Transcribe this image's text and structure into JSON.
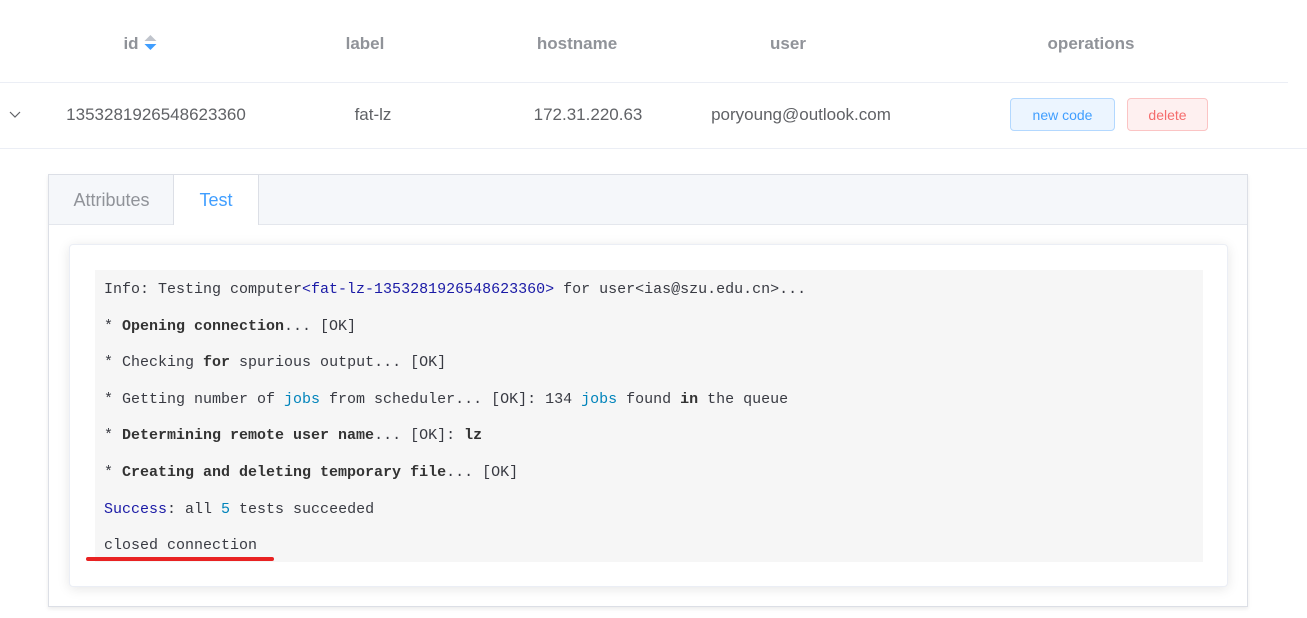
{
  "table": {
    "columns": [
      {
        "key": "id",
        "label": "id",
        "sortable": true,
        "sort": "descending"
      },
      {
        "key": "label",
        "label": "label"
      },
      {
        "key": "hostname",
        "label": "hostname"
      },
      {
        "key": "user",
        "label": "user"
      },
      {
        "key": "operations",
        "label": "operations"
      }
    ],
    "rows": [
      {
        "expanded": true,
        "id": "1353281926548623360",
        "label": "fat-lz",
        "hostname": "172.31.220.63",
        "user": "poryoung@outlook.com",
        "actions": {
          "new_code": "new code",
          "delete": "delete"
        }
      }
    ]
  },
  "detail": {
    "tabs": [
      {
        "label": "Attributes",
        "active": false
      },
      {
        "label": "Test",
        "active": true
      }
    ],
    "log": {
      "lines": [
        [
          {
            "t": "Info: Testing computer"
          },
          {
            "t": "<fat-lz-1353281926548623360>",
            "c": "succ"
          },
          {
            "t": " for user<ias@szu.edu.cn>..."
          }
        ],
        [
          {
            "t": "* "
          },
          {
            "t": "Opening connection",
            "c": "b"
          },
          {
            "t": "... [OK]"
          }
        ],
        [
          {
            "t": "* Checking "
          },
          {
            "t": "for",
            "c": "b"
          },
          {
            "t": " spurious output... [OK]"
          }
        ],
        [
          {
            "t": "* Getting number of "
          },
          {
            "t": "jobs",
            "c": "lit"
          },
          {
            "t": " from scheduler... [OK]: 134 "
          },
          {
            "t": "jobs",
            "c": "lit"
          },
          {
            "t": " found "
          },
          {
            "t": "in",
            "c": "b"
          },
          {
            "t": " the queue"
          }
        ],
        [
          {
            "t": "* "
          },
          {
            "t": "Determining remote user name",
            "c": "b"
          },
          {
            "t": "... [OK]: "
          },
          {
            "t": "lz",
            "c": "b"
          }
        ],
        [
          {
            "t": "* "
          },
          {
            "t": "Creating and deleting temporary file",
            "c": "b"
          },
          {
            "t": "... [OK]"
          }
        ],
        [
          {
            "t": "Success",
            "c": "succ"
          },
          {
            "t": ": all "
          },
          {
            "t": "5",
            "c": "lit"
          },
          {
            "t": " tests succeeded"
          }
        ],
        [
          {
            "t": "closed connection"
          }
        ]
      ]
    }
  },
  "annotation": {
    "underline_color": "#e82222",
    "target_line": "closed connection"
  }
}
